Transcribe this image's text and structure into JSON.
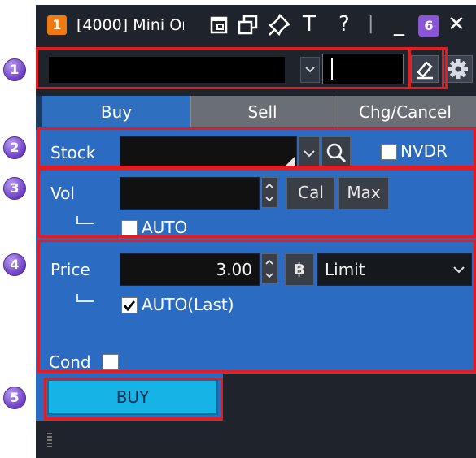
{
  "window": {
    "number": "1",
    "title": "[4000] Mini Or",
    "text_icon": "T",
    "help_icon": "?",
    "separator": "|",
    "minimize": "_",
    "badge": "6",
    "close": "✕"
  },
  "tabs": [
    {
      "label": "Buy",
      "active": true
    },
    {
      "label": "Sell",
      "active": false
    },
    {
      "label": "Chg/Cancel",
      "active": false
    }
  ],
  "form": {
    "stock_label": "Stock",
    "stock_value": "",
    "nvdr_label": "NVDR",
    "vol_label": "Vol",
    "vol_value": "",
    "cal_label": "Cal",
    "max_label": "Max",
    "vol_auto_label": "AUTO",
    "price_label": "Price",
    "price_value": "3.00",
    "currency_icon": "฿",
    "order_type": "Limit",
    "price_auto_label": "AUTO(Last)",
    "cond_label": "Cond"
  },
  "buy_button": "BUY",
  "annotations": [
    "1",
    "2",
    "3",
    "4",
    "5"
  ],
  "colors": {
    "annotation_box": "#e11d23",
    "marker": "#7a4fd0",
    "buy_button": "#16b3e6",
    "body": "#2b6cc2"
  }
}
